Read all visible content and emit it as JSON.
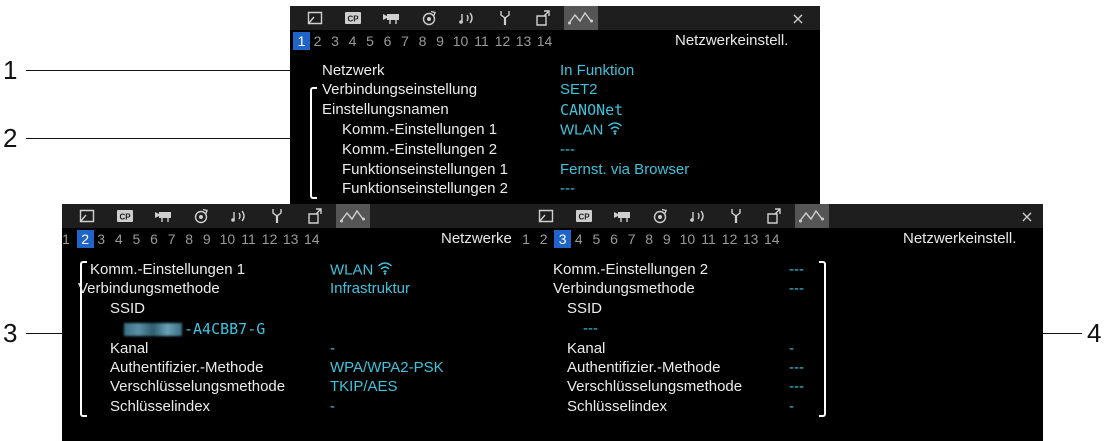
{
  "callouts": [
    "1",
    "2",
    "3",
    "4"
  ],
  "tab_icons": [
    "image-icon",
    "cp-icon",
    "camera-icon",
    "dial-icon",
    "audio-icon",
    "wrench-icon",
    "custom-icon",
    "network-icon"
  ],
  "close_glyph": "×",
  "page_numbers": [
    "1",
    "2",
    "3",
    "4",
    "5",
    "6",
    "7",
    "8",
    "9",
    "10",
    "11",
    "12",
    "13",
    "14"
  ],
  "menu_title": "Netzwerkeinstell.",
  "menu_title_cut": "Netzwerke",
  "panel1": {
    "current_page": "1",
    "rows": [
      {
        "label": "Netzwerk",
        "value": "In Funktion"
      },
      {
        "label": "Verbindungseinstellung",
        "value": "SET2"
      },
      {
        "label": "Einstellungsnamen",
        "value": "CANONet"
      },
      {
        "label": "Komm.-Einstellungen 1",
        "value": "WLAN"
      },
      {
        "label": "Komm.-Einstellungen 2",
        "value": "---"
      },
      {
        "label": "Funktionseinstellungen 1",
        "value": "Fernst. via Browser"
      },
      {
        "label": "Funktionseinstellungen 2",
        "value": "---"
      }
    ]
  },
  "panel2": {
    "current_page": "2",
    "rows": [
      {
        "label": "Komm.-Einstellungen 1",
        "value": "WLAN"
      },
      {
        "label": "Verbindungsmethode",
        "value": "Infrastruktur"
      },
      {
        "label": "SSID",
        "value": ""
      },
      {
        "label": "",
        "value": "-A4CBB7-G"
      },
      {
        "label": "Kanal",
        "value": "-"
      },
      {
        "label": "Authentifizier.-Methode",
        "value": "WPA/WPA2-PSK"
      },
      {
        "label": "Verschlüsselungsmethode",
        "value": "TKIP/AES"
      },
      {
        "label": "Schlüsselindex",
        "value": "-"
      }
    ]
  },
  "panel3": {
    "current_page": "3",
    "rows": [
      {
        "label": "Komm.-Einstellungen 2",
        "value": "---"
      },
      {
        "label": "Verbindungsmethode",
        "value": "---"
      },
      {
        "label": "SSID",
        "value": ""
      },
      {
        "label": "",
        "value": "---"
      },
      {
        "label": "Kanal",
        "value": "-"
      },
      {
        "label": "Authentifizier.-Methode",
        "value": "---"
      },
      {
        "label": "Verschlüsselungsmethode",
        "value": "---"
      },
      {
        "label": "Schlüsselindex",
        "value": "-"
      }
    ]
  },
  "colors": {
    "value": "#3fc2dc",
    "current_page": "#1f64c8",
    "active_tab": "#555555"
  }
}
